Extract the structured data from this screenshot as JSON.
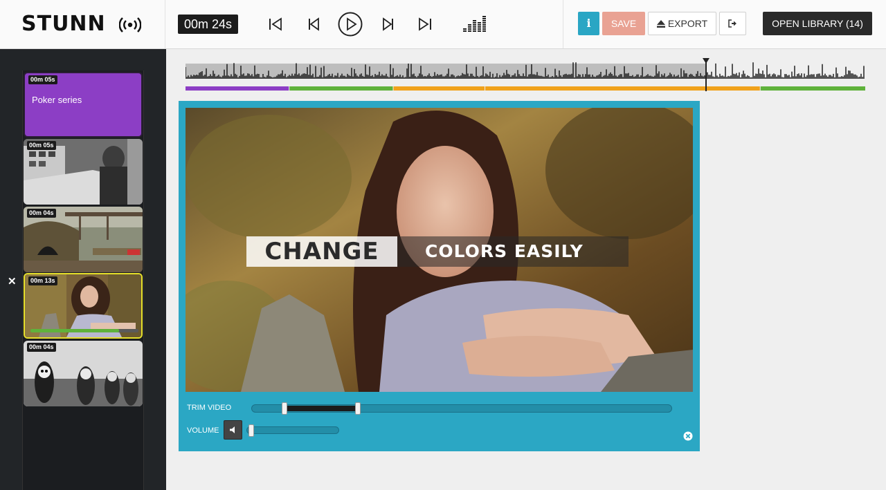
{
  "header": {
    "logo": "STUNN",
    "timer": "00m 24s",
    "info_label": "i",
    "save_label": "SAVE",
    "export_label": "EXPORT",
    "library_label": "OPEN LIBRARY (14)",
    "icons": [
      "broadcast-icon",
      "skip-to-start-icon",
      "previous-icon",
      "play-icon",
      "next-icon",
      "skip-to-end-icon",
      "equalizer-icon",
      "eject-icon",
      "logout-icon"
    ]
  },
  "clips": [
    {
      "duration": "00m 05s",
      "title": "Poker series",
      "color": "#8c3ec5"
    },
    {
      "duration": "00m 05s",
      "title": ""
    },
    {
      "duration": "00m 04s",
      "title": ""
    },
    {
      "duration": "00m 13s",
      "title": "",
      "selected": true,
      "progress": 0.82
    },
    {
      "duration": "00m 04s",
      "title": ""
    }
  ],
  "timeline": {
    "playhead": 0.765,
    "segments": [
      {
        "color": "#8c3ec5",
        "start": 0.0,
        "end": 0.152
      },
      {
        "color": "#5fb23b",
        "start": 0.153,
        "end": 0.305
      },
      {
        "color": "#f0a21c",
        "start": 0.306,
        "end": 0.44
      },
      {
        "color": "#f0a21c",
        "start": 0.441,
        "end": 0.845
      },
      {
        "color": "#5fb23b",
        "start": 0.846,
        "end": 1.0
      }
    ]
  },
  "preview": {
    "overlay_left": "CHANGE",
    "overlay_right": "COLORS EASILY"
  },
  "controls": {
    "trim_label": "TRIM VIDEO",
    "volume_label": "VOLUME",
    "trim_start": 0.078,
    "trim_end": 0.252,
    "volume": 0.02
  },
  "colors": {
    "accent": "#2ba7c4",
    "save": "#e9a293",
    "library": "#2a2a2a"
  }
}
